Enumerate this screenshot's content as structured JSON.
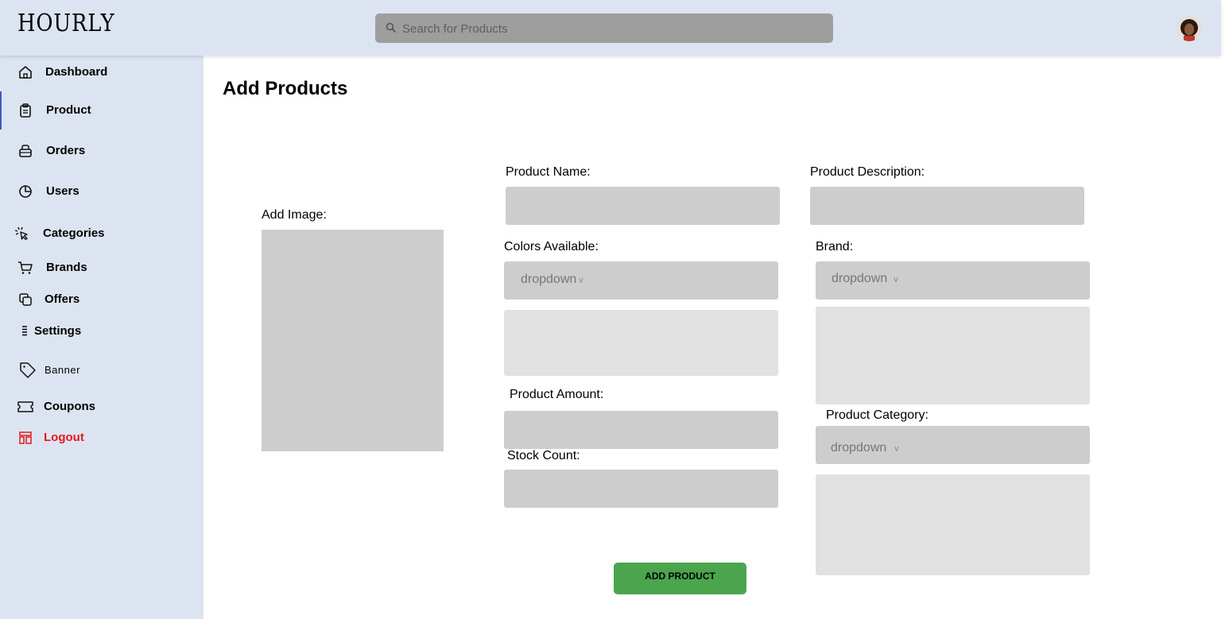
{
  "app": {
    "logo": "HOURLY"
  },
  "search": {
    "placeholder": "Search for Products"
  },
  "sidebar": {
    "items": [
      {
        "label": "Dashboard"
      },
      {
        "label": "Product"
      },
      {
        "label": "Orders"
      },
      {
        "label": "Users"
      },
      {
        "label": "Categories"
      },
      {
        "label": "Brands"
      },
      {
        "label": "Offers"
      },
      {
        "label": "Settings"
      },
      {
        "label": "Banner"
      },
      {
        "label": "Coupons"
      },
      {
        "label": "Logout"
      }
    ],
    "active": "Product",
    "logout_color": "#e21b1b"
  },
  "main": {
    "title": "Add Products",
    "image_label": "Add Image:",
    "fields": {
      "product_name": "Product Name:",
      "product_description": "Product Description:",
      "colors_available": "Colors Available:",
      "brand": "Brand:",
      "product_amount": "Product Amount:",
      "product_category": "Product Category:",
      "stock_count": "Stock Count:"
    },
    "dropdowns": {
      "colors": "dropdown",
      "brand": "dropdown",
      "category": "dropdown"
    },
    "submit_label": "ADD PRODUCT"
  },
  "colors": {
    "sidebar_bg": "#dde4f1",
    "button_bg": "#4aa54d",
    "field_bg": "#cdcdcd"
  }
}
